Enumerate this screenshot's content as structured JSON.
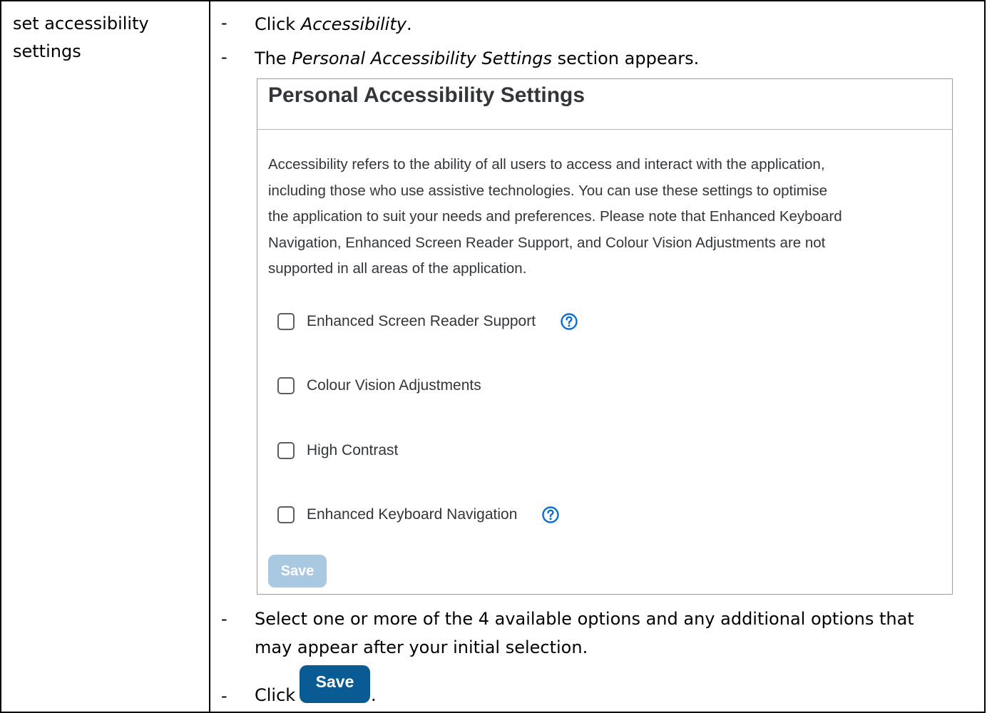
{
  "left_cell": {
    "lines": [
      "set accessibility",
      "settings"
    ]
  },
  "steps": {
    "step1": {
      "dash": "-",
      "prefix": "Click ",
      "italic": "Accessibility",
      "suffix": "."
    },
    "step2": {
      "dash": "-",
      "prefix": "The ",
      "italic": "Personal Accessibility Settings",
      "suffix": " section appears."
    },
    "step3": {
      "dash": "-",
      "line1": "Select one or more of the 4 available options and any additional options that",
      "line2": "may appear after your initial selection."
    },
    "step4": {
      "dash": "-",
      "prefix": "Click",
      "suffix": "."
    }
  },
  "panel": {
    "title": "Personal Accessibility Settings",
    "description": [
      "Accessibility refers to the ability of all users to access and interact with the application,",
      "including those who use assistive technologies. You can use these settings to optimise",
      "the application to suit your needs and preferences. Please note that Enhanced Keyboard",
      "Navigation, Enhanced Screen Reader Support, and Colour Vision Adjustments are not",
      "supported in all areas of the application."
    ],
    "options": [
      {
        "label": "Enhanced Screen Reader Support",
        "checked": false,
        "help_icon": "help-circle-icon"
      },
      {
        "label": "Colour Vision Adjustments",
        "checked": false
      },
      {
        "label": "High Contrast",
        "checked": false
      },
      {
        "label": "Enhanced Keyboard Navigation",
        "checked": false,
        "help_icon": "help-circle-icon"
      }
    ],
    "save_label": "Save",
    "save_state": "disabled"
  },
  "inline_save_label": "Save",
  "colors": {
    "help_icon": "#0a6ed1",
    "save_disabled_bg": "#a9c8e2",
    "save_enabled_bg": "#0a5b94",
    "panel_text": "#32363a"
  }
}
